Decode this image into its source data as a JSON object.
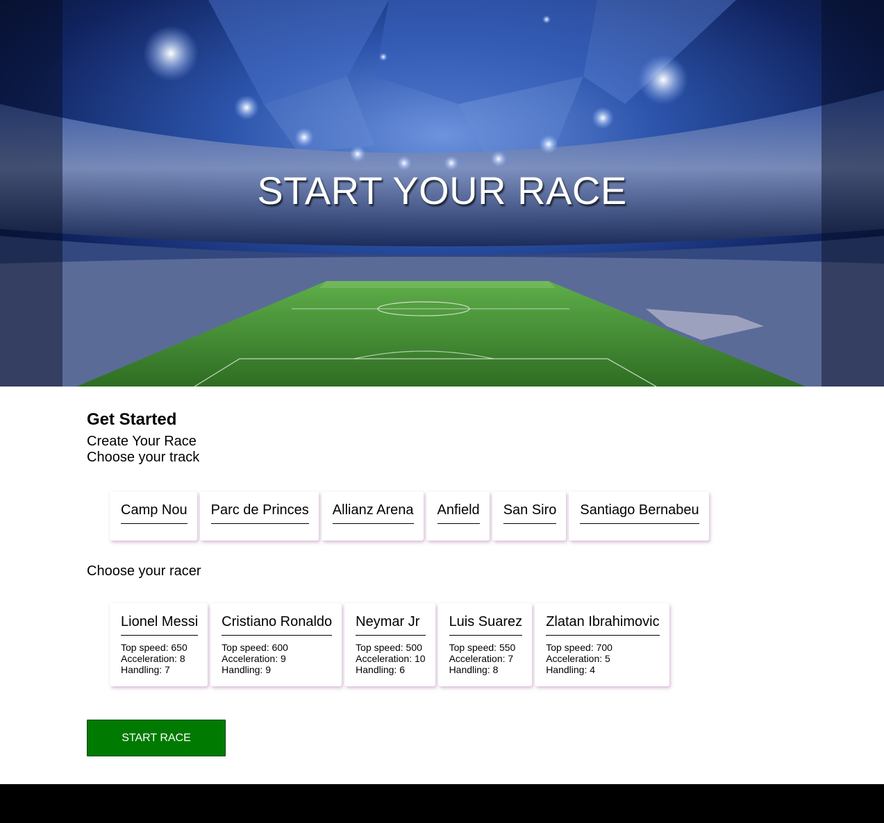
{
  "hero": {
    "title": "START YOUR RACE"
  },
  "main": {
    "heading": "Get Started",
    "subtitle": "Create Your Race",
    "track_prompt": "Choose your track",
    "racer_prompt": "Choose your racer",
    "start_button": "START RACE"
  },
  "tracks": [
    {
      "name": "Camp Nou"
    },
    {
      "name": "Parc de Princes"
    },
    {
      "name": "Allianz Arena"
    },
    {
      "name": "Anfield"
    },
    {
      "name": "San Siro"
    },
    {
      "name": "Santiago Bernabeu"
    }
  ],
  "racers": [
    {
      "name": "Lionel Messi",
      "top_speed": "Top speed: 650",
      "acceleration": "Acceleration: 8",
      "handling": "Handling: 7"
    },
    {
      "name": "Cristiano Ronaldo",
      "top_speed": "Top speed: 600",
      "acceleration": "Acceleration: 9",
      "handling": "Handling: 9"
    },
    {
      "name": "Neymar Jr",
      "top_speed": "Top speed: 500",
      "acceleration": "Acceleration: 10",
      "handling": "Handling: 6"
    },
    {
      "name": "Luis Suarez",
      "top_speed": "Top speed: 550",
      "acceleration": "Acceleration: 7",
      "handling": "Handling: 8"
    },
    {
      "name": "Zlatan Ibrahimovic",
      "top_speed": "Top speed: 700",
      "acceleration": "Acceleration: 5",
      "handling": "Handling: 4"
    }
  ],
  "colors": {
    "start_button": "#007a00",
    "footer": "#000000",
    "hero_sky": "#2a4ea3",
    "pitch": "#3e8a2e"
  }
}
